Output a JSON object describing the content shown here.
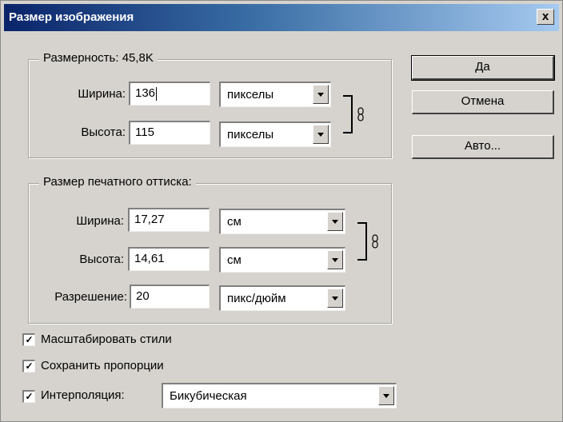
{
  "dialog": {
    "title": "Размер изображения",
    "close_glyph": "x"
  },
  "pixel_dims": {
    "legend": "Размерность: 45,8K",
    "width_label": "Ширина:",
    "width_value": "136",
    "width_unit": "пикселы",
    "height_label": "Высота:",
    "height_value": "115",
    "height_unit": "пикселы"
  },
  "print_size": {
    "legend": "Размер печатного оттиска:",
    "width_label": "Ширина:",
    "width_value": "17,27",
    "width_unit": "см",
    "height_label": "Высота:",
    "height_value": "14,61",
    "height_unit": "см",
    "resolution_label": "Разрешение:",
    "resolution_value": "20",
    "resolution_unit": "пикс/дюйм"
  },
  "buttons": {
    "ok": "Да",
    "cancel": "Отмена",
    "auto": "Авто..."
  },
  "options": {
    "scale_styles": "Масштабировать стили",
    "constrain_proportions": "Сохранить пропорции",
    "resample": "Интерполяция:",
    "resample_method": "Бикубическая",
    "check_mark": "✓",
    "scale_styles_checked": true,
    "constrain_proportions_checked": true,
    "resample_checked": true
  },
  "icons": {
    "link": "chain-link-icon",
    "dropdown": "chevron-down-icon"
  }
}
